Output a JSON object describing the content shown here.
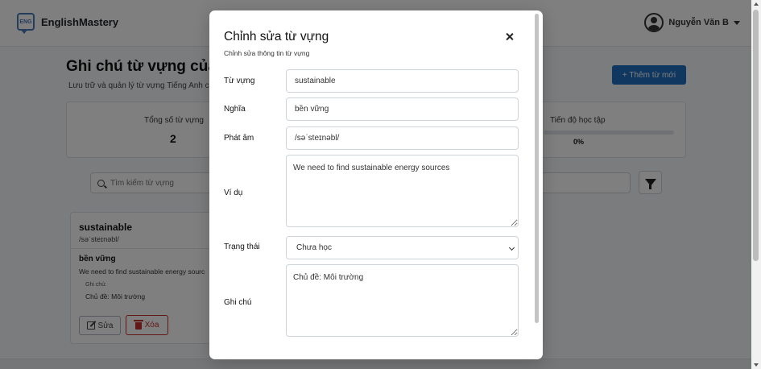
{
  "navbar": {
    "brand_icon_text": "ENG",
    "brand_name": "EnglishMastery",
    "user_name": "Nguyễn Văn B"
  },
  "page": {
    "title": "Ghi chú từ vựng của",
    "subtitle": "Lưu trữ và quản lý từ vựng Tiếng Anh c",
    "add_button": "+ Thêm từ mới"
  },
  "stats": {
    "total_label": "Tổng số từ vựng",
    "total_value": "2",
    "progress_label": "Tiến độ học tập",
    "progress_value": "0%",
    "progress_fraction": 0
  },
  "search": {
    "placeholder": "Tìm kiếm từ vựng"
  },
  "card": {
    "word": "sustainable",
    "phonetic": "/səˈsteɪnəbl/",
    "meaning": "bền vững",
    "example": "We need to find sustainable energy sourc",
    "note_label": "Ghi chú:",
    "note": "Chủ đề: Môi trường",
    "edit_label": "Sửa",
    "delete_label": "Xóa"
  },
  "modal": {
    "title": "Chỉnh sửa từ vựng",
    "subtitle": "Chỉnh sửa thông tin từ vựng",
    "word_label": "Từ vựng",
    "word_value": "sustainable",
    "meaning_label": "Nghĩa",
    "meaning_value": "bền vững",
    "phonetic_label": "Phát âm",
    "phonetic_value": "/səˈsteɪnəbl/",
    "example_label": "Ví dụ",
    "example_value": "We need to find sustainable energy sources",
    "status_label": "Trạng thái",
    "status_value": "Chưa học",
    "note_label": "Ghi chú",
    "note_value": "Chủ đề: Môi trường"
  },
  "colors": {
    "primary": "#1f6fbf",
    "danger": "#c9302c"
  }
}
